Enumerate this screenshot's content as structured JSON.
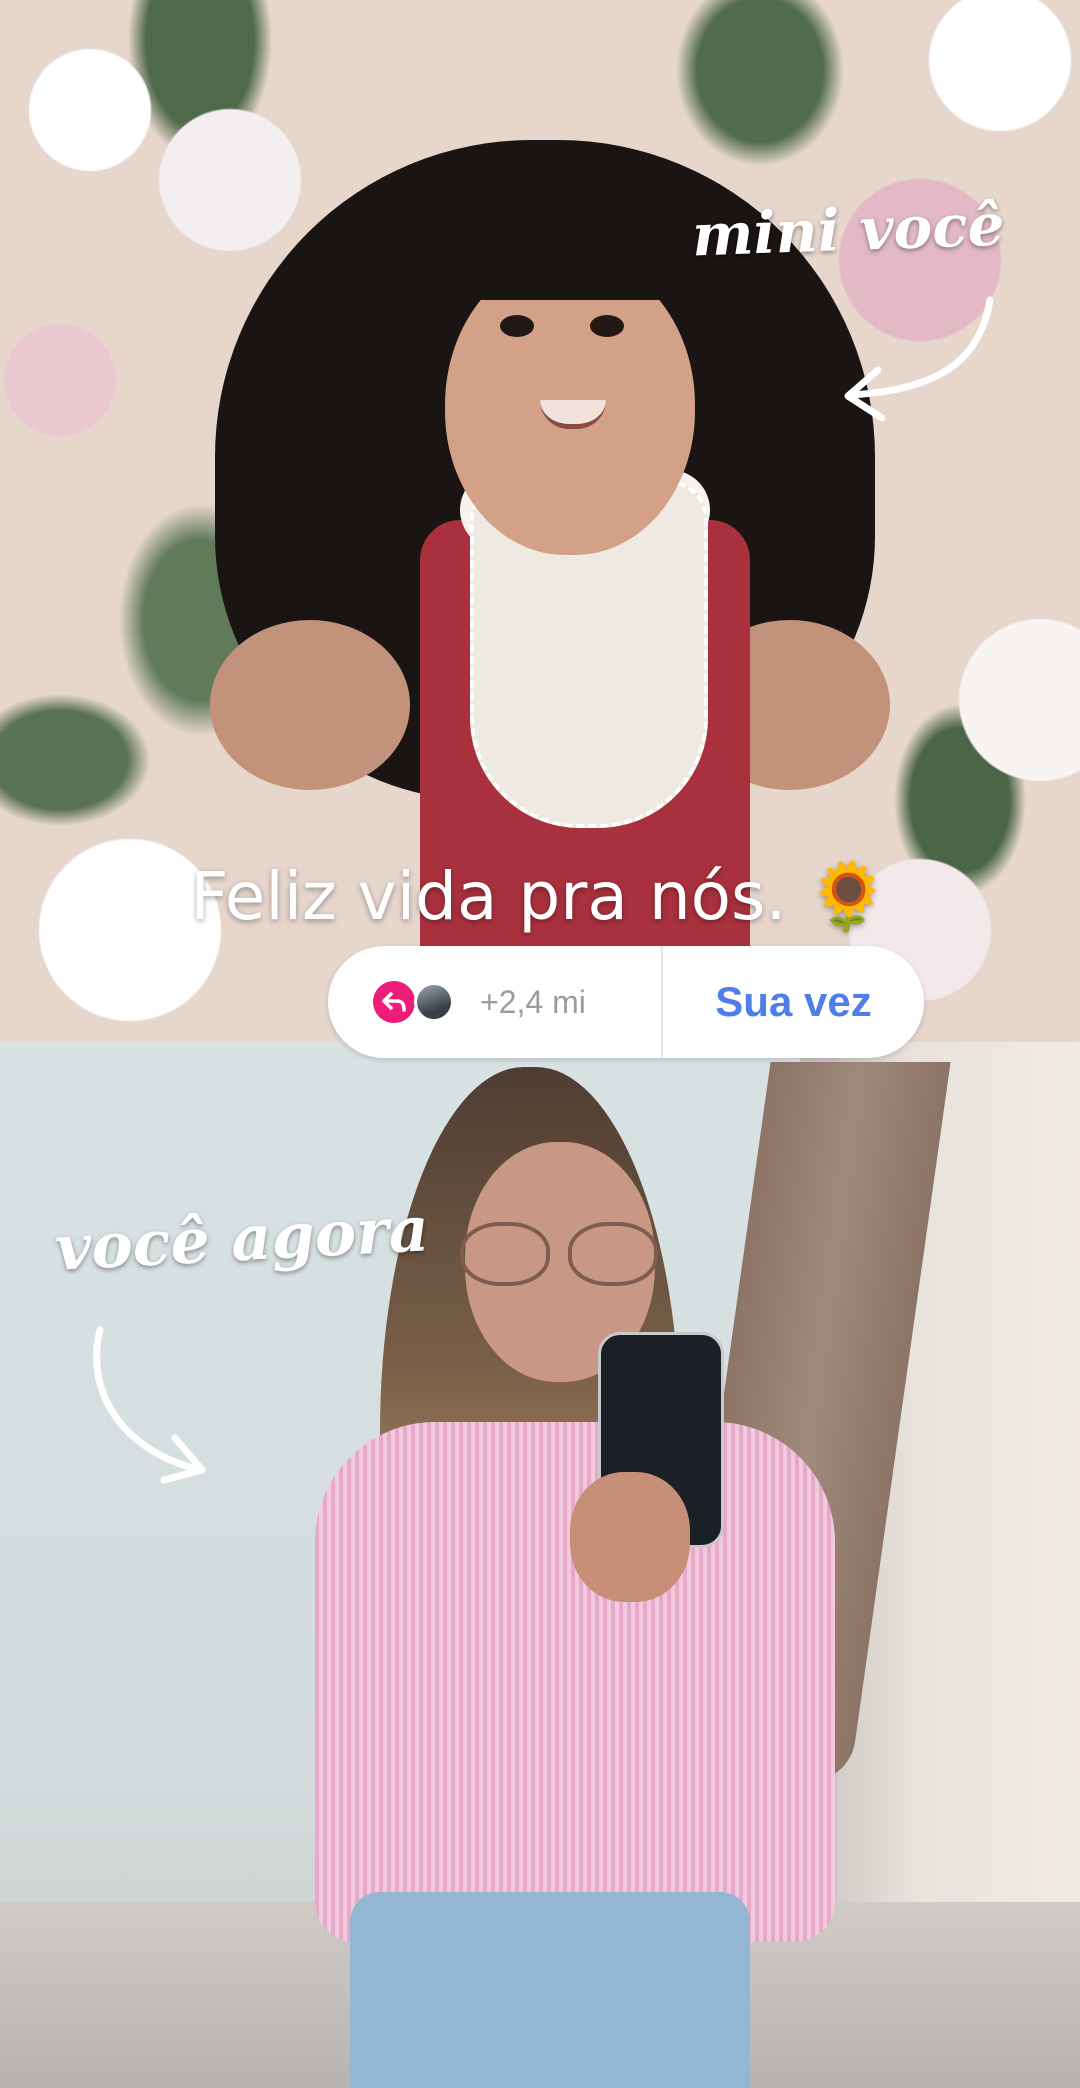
{
  "caption": {
    "text": "Feliz vida pra nós. 🌻"
  },
  "labels": {
    "top": "mini você",
    "bottom": "você agora"
  },
  "template_pill": {
    "reply_icon": "reply-arrow-icon",
    "count": "+2,4 mi",
    "cta_label": "Sua vez",
    "colors": {
      "reply": "#ee1d7a",
      "cta": "#4f7ee8"
    }
  },
  "photos": {
    "top": "childhood-photo",
    "bottom": "adult-selfie"
  }
}
